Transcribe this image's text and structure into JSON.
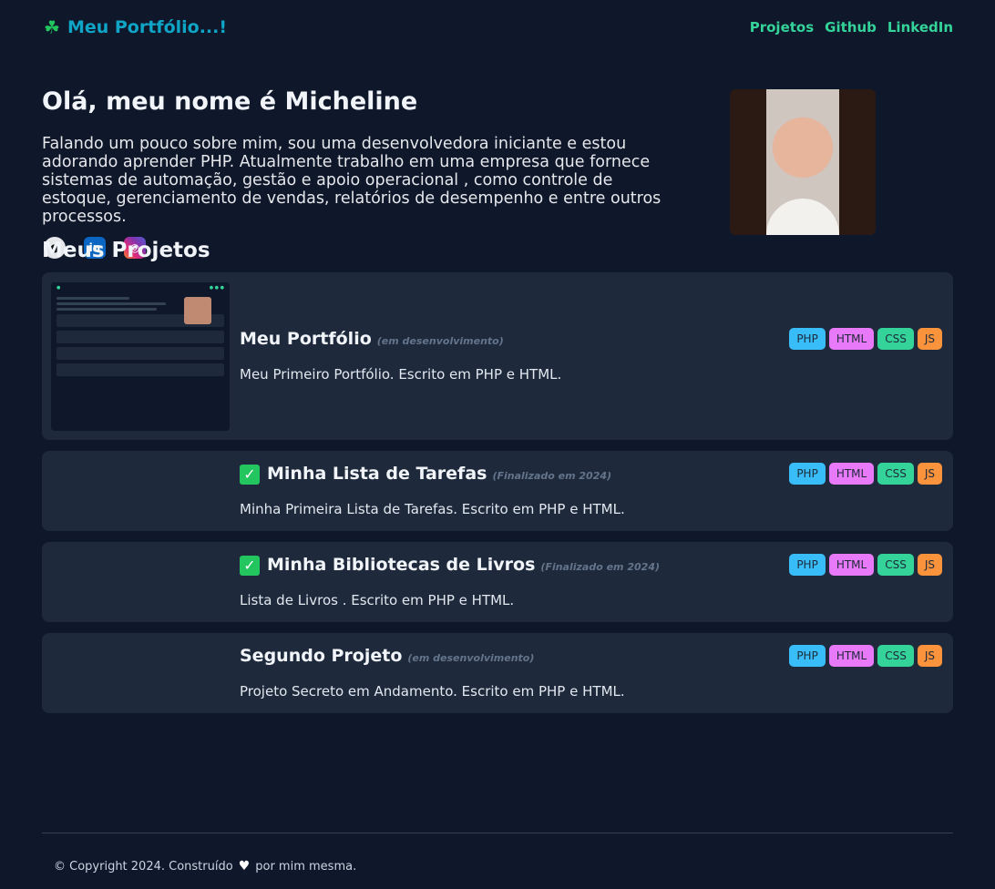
{
  "header": {
    "brand_title": "Meu Portfólio...!",
    "nav": [
      "Projetos",
      "Github",
      "LinkedIn"
    ]
  },
  "hero": {
    "greeting": "Olá, meu nome é Micheline",
    "bio": "Falando um pouco sobre mim, sou uma desenvolvedora iniciante e estou adorando aprender PHP. Atualmente trabalho em uma empresa que fornece sistemas de automação, gestão e apoio operacional , como controle de estoque, gerenciamento de vendas, relatórios de desempenho e entre outros processos.",
    "social": [
      "github-icon",
      "linkedin-icon",
      "instagram-icon"
    ]
  },
  "projects_section": {
    "title": "Meus Projetos",
    "items": [
      {
        "title": "Meu Portfólio",
        "status": "(em desenvolvimento)",
        "description": "Meu Primeiro Portfólio. Escrito em PHP e HTML.",
        "done": false,
        "tags": [
          "PHP",
          "HTML",
          "CSS",
          "JS"
        ]
      },
      {
        "title": "Minha Lista de Tarefas",
        "status": "(Finalizado em 2024)",
        "description": "Minha Primeira Lista de Tarefas. Escrito em PHP e HTML.",
        "done": true,
        "tags": [
          "PHP",
          "HTML",
          "CSS",
          "JS"
        ]
      },
      {
        "title": "Minha Bibliotecas de Livros",
        "status": "(Finalizado em 2024)",
        "description": "Lista de Livros . Escrito em PHP e HTML.",
        "done": true,
        "tags": [
          "PHP",
          "HTML",
          "CSS",
          "JS"
        ]
      },
      {
        "title": "Segundo Projeto",
        "status": "(em desenvolvimento)",
        "description": "Projeto Secreto em Andamento. Escrito em PHP e HTML.",
        "done": false,
        "tags": [
          "PHP",
          "HTML",
          "CSS",
          "JS"
        ]
      }
    ]
  },
  "footer": {
    "copyright": "© Copyright 2024. Construído",
    "suffix": "por mim mesma."
  },
  "colors": {
    "background": "#0f172a",
    "card": "#1e293b",
    "brand": "#0ea5c6",
    "nav": "#34d399",
    "php": "#38bdf8",
    "html": "#e879f9",
    "css": "#34d399",
    "js": "#fb923c"
  }
}
